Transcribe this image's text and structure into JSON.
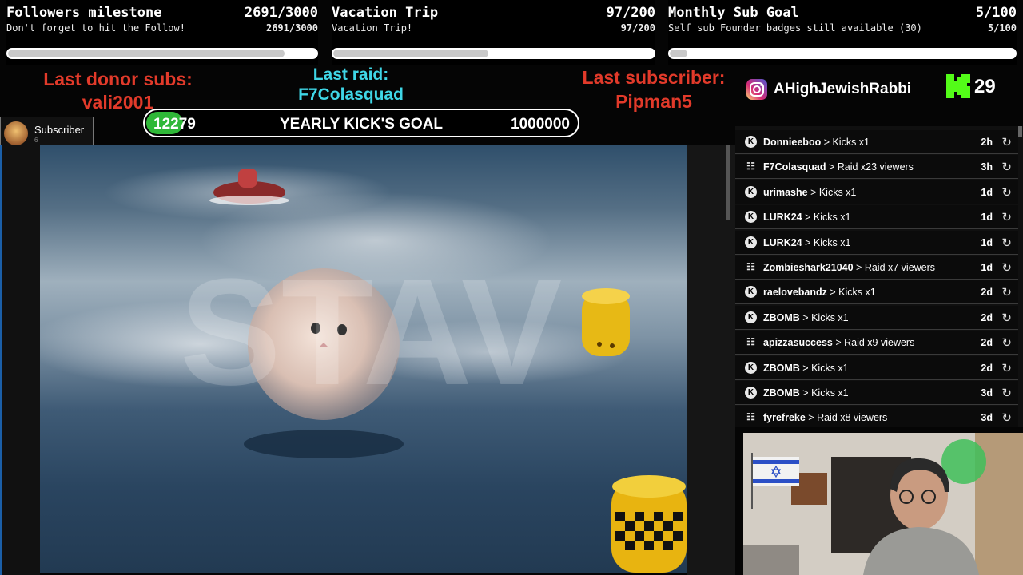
{
  "goals": [
    {
      "title": "Followers milestone",
      "count": "2691/3000",
      "subtitle": "Don't forget to hit the Follow!",
      "count_small": "2691/3000",
      "progress": 0.897
    },
    {
      "title": "Vacation Trip",
      "count": "97/200",
      "subtitle": "Vacation Trip!",
      "count_small": "97/200",
      "progress": 0.485
    },
    {
      "title": "Monthly Sub Goal",
      "count": "5/100",
      "subtitle": "Self sub Founder badges still available (30)",
      "count_small": "5/100",
      "progress": 0.05
    }
  ],
  "last_donor": {
    "label": "Last donor subs:",
    "name": "vali2001"
  },
  "last_raid": {
    "label": "Last raid:",
    "name": "F7Colasquad"
  },
  "last_subscriber": {
    "label": "Last subscriber:",
    "name": "Pipman5"
  },
  "instagram": {
    "handle": "AHighJewishRabbi",
    "icon": "instagram-icon"
  },
  "kick": {
    "icon": "kick-logo-icon",
    "count": "29"
  },
  "kick_goal": {
    "current": "12279",
    "label": "YEARLY KICK'S GOAL",
    "target": "1000000",
    "progress": 0.012
  },
  "subscriber_badge": {
    "label": "Subscriber",
    "sub": "6"
  },
  "video": {
    "watermark": "STAV"
  },
  "events": [
    {
      "type": "kick",
      "user": "Donnieeboo",
      "action": "Kicks x1",
      "time": "2h"
    },
    {
      "type": "raid",
      "user": "F7Colasquad",
      "action": "Raid x23 viewers",
      "time": "3h"
    },
    {
      "type": "kick",
      "user": "urimashe",
      "action": "Kicks x1",
      "time": "1d"
    },
    {
      "type": "kick",
      "user": "LURK24",
      "action": "Kicks x1",
      "time": "1d"
    },
    {
      "type": "kick",
      "user": "LURK24",
      "action": "Kicks x1",
      "time": "1d"
    },
    {
      "type": "raid",
      "user": "Zombieshark21040",
      "action": "Raid x7 viewers",
      "time": "1d"
    },
    {
      "type": "kick",
      "user": "raelovebandz",
      "action": "Kicks x1",
      "time": "2d"
    },
    {
      "type": "kick",
      "user": "ZBOMB",
      "action": "Kicks x1",
      "time": "2d"
    },
    {
      "type": "raid",
      "user": "apizzasuccess",
      "action": "Raid x9 viewers",
      "time": "2d"
    },
    {
      "type": "kick",
      "user": "ZBOMB",
      "action": "Kicks x1",
      "time": "2d"
    },
    {
      "type": "kick",
      "user": "ZBOMB",
      "action": "Kicks x1",
      "time": "3d"
    },
    {
      "type": "raid",
      "user": "fyrefreke",
      "action": "Raid x8 viewers",
      "time": "3d"
    }
  ],
  "colors": {
    "red": "#e23a2a",
    "cyan": "#3fd6e6",
    "green": "#2fb838",
    "kick_green": "#53fc18"
  }
}
